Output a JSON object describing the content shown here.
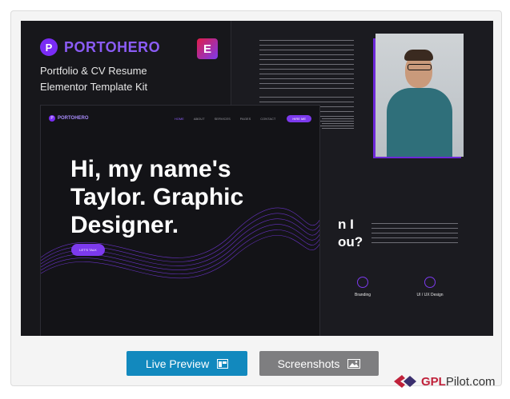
{
  "preview": {
    "brand": "PORTOHERO",
    "brand_letter": "P",
    "subtitle_line1": "Portfolio & CV Resume",
    "subtitle_line2": "Elementor Template Kit",
    "elementor_letter": "E",
    "inner": {
      "brand": "PORTOHERO",
      "brand_letter": "P",
      "nav": [
        "HOME",
        "ABOUT",
        "SERVICES",
        "PAGES",
        "CONTACT"
      ],
      "hire_button": "HIRE ME",
      "hero_line1": "Hi, my name's",
      "hero_line2": "Taylor. Graphic",
      "hero_line3": "Designer.",
      "talk_button": "LET'S TALK"
    },
    "right": {
      "question_line1": "n I",
      "question_line2": "ou?",
      "services": [
        "Branding",
        "UI / UX Design"
      ]
    },
    "colors": {
      "accent": "#7c3aed",
      "background": "#17171b"
    }
  },
  "buttons": {
    "live_preview": "Live Preview",
    "screenshots": "Screenshots"
  },
  "watermark": {
    "prefix": "GPL",
    "suffix": "Pilot.com"
  }
}
